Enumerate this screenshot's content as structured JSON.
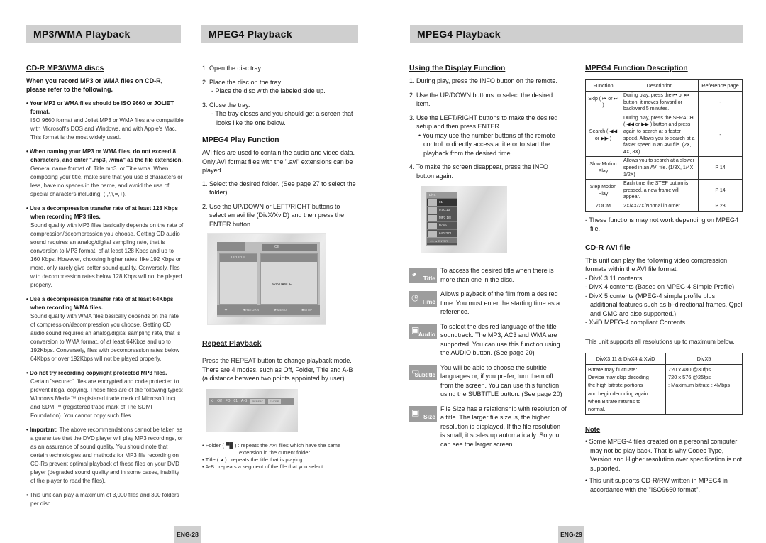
{
  "headers": {
    "left": "MP3/WMA Playback",
    "middle": "MPEG4 Playback",
    "right": "MPEG4 Playback"
  },
  "col1": {
    "title": "CD-R MP3/WMA discs",
    "lead": "When you record MP3 or WMA files on CD-R, please refer to the following.",
    "bullets": [
      {
        "head": "• Your MP3 or WMA files should be ISO 9660 or JOLIET format.",
        "body": "ISO 9660 format and Joliet MP3 or WMA files are compatible with Microsoft's DOS and Windows, and with Apple's Mac. This format is the most widely used."
      },
      {
        "head": "• When naming your MP3 or WMA files, do not exceed 8 characters, and enter \".mp3, .wma\" as the file extension.",
        "body": "General name format of: Title.mp3. or Title.wma. When composing your title, make sure that you use 8 characters or less, have no spaces in the name, and avoid the use of special characters including: (.,/,\\,=,+)."
      },
      {
        "head": "• Use a decompression transfer rate of at least 128 Kbps when recording MP3 files.",
        "body": "Sound quality with MP3 files basically depends on the rate of compression/decompression you choose. Getting CD audio sound requires an analog/digital sampling rate, that is conversion to MP3 format, of at least 128 Kbps and up to 160 Kbps. However, choosing higher rates, like 192 Kbps or more, only rarely give better sound quality. Conversely, files with decompression rates below 128 Kbps will not be played properly."
      },
      {
        "head": "• Use a decompression transfer rate of at least 64Kbps when recording WMA files.",
        "body": "Sound quality with WMA files basically depends on the rate of compression/decompression you choose. Getting CD audio sound requires an analog/digital sampling rate, that is conversion to WMA format, of at least 64Kbps and up to 192Kbps. Conversely, files with decompression rates below 64Kbps or over 192Kbps will not be played properly."
      },
      {
        "head": "• Do not try recording copyright protected MP3 files.",
        "body": "Certain \"secured\" files are encrypted and code protected to prevent illegal copying. These files are of the following types: Windows Media™ (registered trade mark of Microsoft Inc) and SDMI™ (registered trade mark of The SDMI Foundation). You cannot copy such files."
      }
    ],
    "important_label": "• Important:",
    "important_text": " The above recommendations cannot be taken as a guarantee that the DVD player will play MP3 recordings, or as an assurance of sound quality. You should note that certain technologies and methods for MP3 file recording on CD-Rs prevent optimal playback of these files on your DVD player (degraded sound quality and in some cases, inability of the player to read the files).",
    "last": "• This unit can play a maximum of 3,000 files and 300 folders per disc."
  },
  "col2": {
    "steps": [
      {
        "main": "1. Open the disc tray.",
        "sub": ""
      },
      {
        "main": "2. Place the disc on the tray.",
        "sub": "- Place the disc with the labeled side up."
      },
      {
        "main": "3. Close the tray.",
        "sub": "- The tray closes and you should get a screen that looks like the one below."
      }
    ],
    "play_title": "MPEG4 Play Function",
    "play_intro": "AVI files are used to contain the audio and video data. Only AVI format files with the \".avi\" extensions can be played.",
    "play_steps": [
      "1. Select the desired folder. (See page 27 to select the folder)",
      "2. Use the UP/DOWN or LEFT/RIGHT buttons to select an avi file (DivX/XviD) and then press the ENTER button."
    ],
    "screen": {
      "top_label": "Off",
      "time": "00:00:00",
      "file": "WINDANCE",
      "footer": [
        "◄RETURN",
        "►MENU",
        "■STOP"
      ]
    },
    "repeat_title": "Repeat Playback",
    "repeat_text": "Press the REPEAT button to change playback mode. There are 4 modes, such as Off, Folder, Title and A-B (a distance between two points appointed by user).",
    "repeat_bar": [
      "Off",
      "FD",
      "01",
      "A-B",
      "REPEAT",
      "ENTER"
    ],
    "legend": [
      "• Folder ( ▀█ ) : repeats the AVI files which have the same",
      "extension in the current folder.",
      "• Title ( ◕ ) : repeats the title that is playing.",
      "• A-B : repeats a segment of the file that you select."
    ]
  },
  "col3": {
    "title": "Using the Display Function",
    "steps": [
      {
        "main": "1. During play, press the INFO button on the remote.",
        "sub": ""
      },
      {
        "main": "2. Use the UP/DOWN buttons to select the desired item.",
        "sub": ""
      },
      {
        "main": "3. Use the LEFT/RIGHT buttons to make the desired setup and then press ENTER.",
        "sub": "• You may use the number buttons of the remote control to directly access a title or to start the playback from the desired time."
      },
      {
        "main": "4. To make the screen disappear, press the INFO button again.",
        "sub": ""
      }
    ],
    "info_screen": {
      "header": "DivX",
      "rows": [
        "01",
        "0:00:13",
        "MP3 1/8",
        "None",
        "640x272"
      ],
      "footer": "◄► ● ENTER"
    },
    "features": [
      {
        "icon": "title-icon",
        "label": "Title",
        "glyph": "◕",
        "text": "To access the desired title when there is more than one in the disc."
      },
      {
        "icon": "time-icon",
        "label": "Time",
        "glyph": "◷",
        "text": "Allows playback of the film from a desired time. You must enter the starting time as a reference."
      },
      {
        "icon": "audio-icon",
        "label": "Audio",
        "glyph": "▣",
        "text": "To select the desired language of the title soundtrack. The MP3, AC3 and WMA are supported. You can use this function using the AUDIO button. (See page 20)"
      },
      {
        "icon": "subtitle-icon",
        "label": "Subtitle",
        "glyph": "▭",
        "text": "You will be able to choose the subtitle languages or, if you prefer, turn them off from the screen. You can use this function using the SUBTITLE button. (See page 20)"
      },
      {
        "icon": "size-icon",
        "label": "Size",
        "glyph": "▣",
        "text": "File Size has a relationship with resolution of a title. The larger file size is, the higher resolution is displayed. If the file resolution is small, it scales up automatically. So you can see the larger screen."
      }
    ]
  },
  "col4": {
    "title": "MPEG4 Function Description",
    "table": {
      "headers": [
        "Function",
        "Description",
        "Reference page"
      ],
      "rows": [
        {
          "fn": "Skip ( ⏮ or ⏭ )",
          "desc": "During play, press the ⏮ or ⏭ button, it moves forward or backward 5 minutes.",
          "ref": "-"
        },
        {
          "fn": "Search ( ◀◀ or ▶▶ )",
          "desc": "During play, press the SERACH ( ◀◀ or ▶▶ ) button and press again to search at a faster speed. Allows you to search at a faster speed in an AVI file. (2X, 4X, 8X)",
          "ref": "-"
        },
        {
          "fn": "Slow Motion Play",
          "desc": "Allows you to search at a slower speed in an AVI file. (1/8X, 1/4X, 1/2X)",
          "ref": "P 14"
        },
        {
          "fn": "Step Motion Play",
          "desc": "Each time the STEP button is pressed, a new  frame will appear.",
          "ref": "P 14"
        },
        {
          "fn": "ZOOM",
          "desc": "2X/4X/2X/Normal in order",
          "ref": "P 23"
        }
      ]
    },
    "table_note": "- These functions may not work depending on MPEG4 file.",
    "avi_title": "CD-R AVI file",
    "avi_intro": "This unit can play the following video compression formats within the AVI file format:",
    "avi_items": [
      "- DivX 3.11 contents",
      "- DivX 4 contents (Based on MPEG-4 Simple Profile)",
      "- DivX 5 contents (MPEG-4 simple profile plus additional features such as bi-directional frames. Qpel and GMC are also supported.)",
      "- XviD MPEG-4 compliant Contents."
    ],
    "res_intro": "This unit supports all resolutions up to maximum below.",
    "res_table": {
      "headers": [
        "DivX3.11 & DivX4 & XviD",
        "DivX5"
      ],
      "left": [
        "Bitrate may fluctuate:",
        "Device may skip decoding",
        "the high bitrate portions",
        "and begin decoding again",
        "when Bitrate returns to",
        "normal."
      ],
      "right": [
        "720 x 480 @30fps",
        "720 x 576 @25fps",
        ": Maximum bitrate : 4Mbps"
      ]
    },
    "note_title": "Note",
    "notes": [
      "• Some MPEG-4 files created on a personal computer may not be play back. That is why Codec Type, Version and Higher resolution over specification is not supported.",
      "• This unit supports CD-R/RW written in MPEG4 in accordance with the \"ISO9660 format\"."
    ]
  },
  "pages": {
    "left": "ENG-28",
    "right": "ENG-29"
  }
}
